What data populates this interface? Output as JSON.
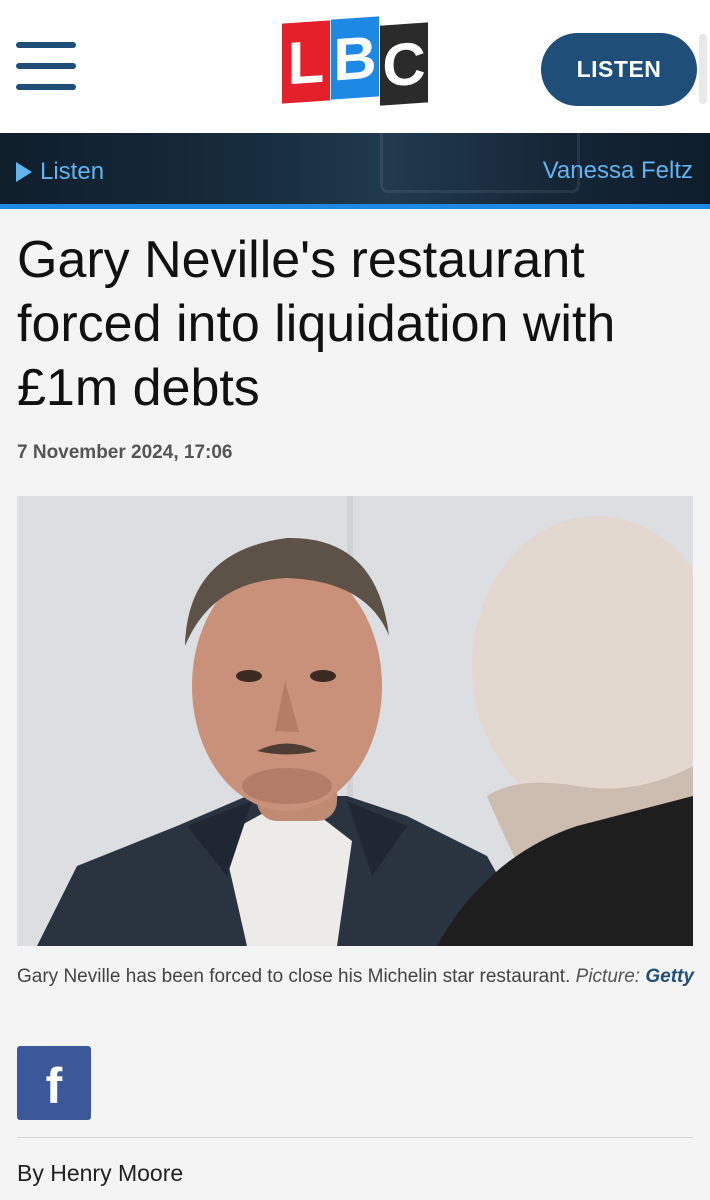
{
  "header": {
    "logo_letters": [
      "L",
      "B",
      "C"
    ],
    "listen_button": "LISTEN",
    "menu_icon": "hamburger-menu-icon"
  },
  "listen_bar": {
    "listen_label": "Listen",
    "presenter": "Vanessa Feltz",
    "play_icon": "play-icon"
  },
  "article": {
    "headline": "Gary Neville's restaurant forced into liquidation with £1m debts",
    "date": "7 November 2024, 17:06",
    "caption_text": "Gary Neville has been forced to close his Michelin star restaurant.",
    "caption_credit_label": "Picture:",
    "caption_credit": "Getty",
    "byline": "By Henry Moore"
  },
  "share": {
    "facebook_icon": "facebook-icon",
    "facebook_glyph": "f"
  },
  "colors": {
    "brand_navy": "#1f4e79",
    "accent_blue": "#1e88e5",
    "link_blue": "#62b4f0",
    "logo_red": "#e4202a",
    "logo_dark": "#2b2b2b",
    "facebook_blue": "#3b5998"
  }
}
